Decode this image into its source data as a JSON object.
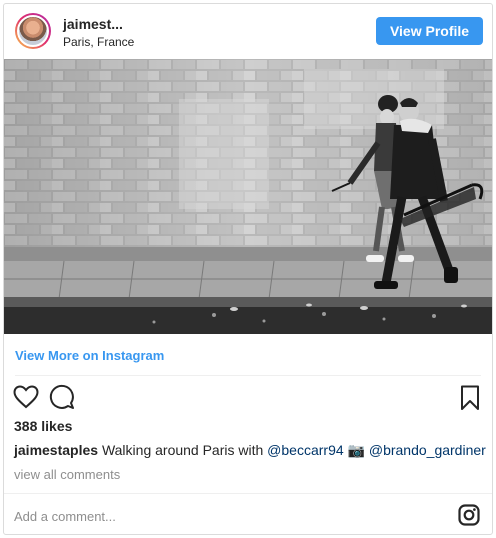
{
  "header": {
    "username": "jaimest...",
    "location": "Paris, France",
    "view_profile_label": "View Profile"
  },
  "post": {
    "view_more_label": "View More on Instagram",
    "likes": "388 likes",
    "caption_user": "jaimestaples",
    "caption_text_1": " Walking around Paris with ",
    "caption_mention_1": "@beccarr94",
    "caption_text_2": " 📷 ",
    "caption_mention_2": "@brando_gardiner",
    "view_comments_label": "view all comments"
  },
  "comment": {
    "placeholder": "Add a comment..."
  },
  "icons": [
    "heart-icon",
    "comment-icon",
    "bookmark-icon",
    "instagram-logo-icon"
  ],
  "colors": {
    "accent": "#3897f0",
    "mention": "#003569",
    "muted": "#8e8e8e"
  }
}
